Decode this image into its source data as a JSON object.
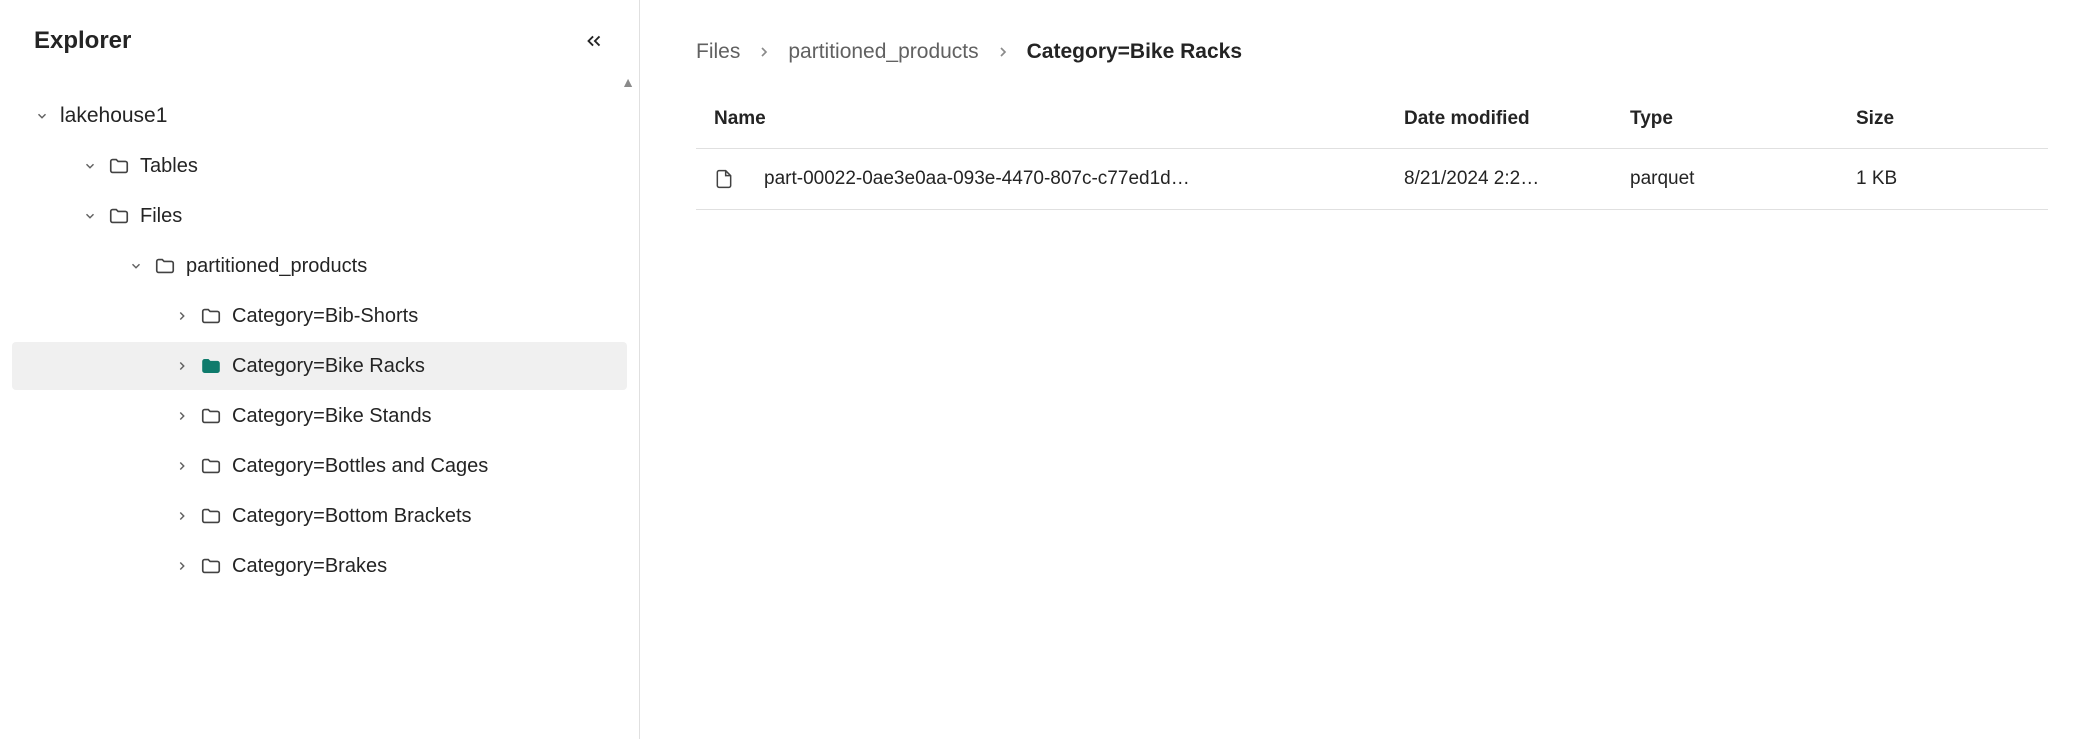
{
  "sidebar": {
    "title": "Explorer",
    "root": "lakehouse1",
    "nodes_lvl1": [
      {
        "label": "Tables",
        "expanded": true
      },
      {
        "label": "Files",
        "expanded": true
      }
    ],
    "nodes_lvl2": [
      {
        "label": "partitioned_products",
        "expanded": true
      }
    ],
    "nodes_lvl3": [
      {
        "label": "Category=Bib-Shorts",
        "selected": false
      },
      {
        "label": "Category=Bike Racks",
        "selected": true
      },
      {
        "label": "Category=Bike Stands",
        "selected": false
      },
      {
        "label": "Category=Bottles and Cages",
        "selected": false
      },
      {
        "label": "Category=Bottom Brackets",
        "selected": false
      },
      {
        "label": "Category=Brakes",
        "selected": false
      }
    ]
  },
  "breadcrumb": {
    "items": [
      "Files",
      "partitioned_products",
      "Category=Bike Racks"
    ]
  },
  "table": {
    "headers": {
      "name": "Name",
      "date": "Date modified",
      "type": "Type",
      "size": "Size"
    },
    "rows": [
      {
        "name": "part-00022-0ae3e0aa-093e-4470-807c-c77ed1d…",
        "date": "8/21/2024 2:2…",
        "type": "parquet",
        "size": "1 KB"
      }
    ]
  }
}
